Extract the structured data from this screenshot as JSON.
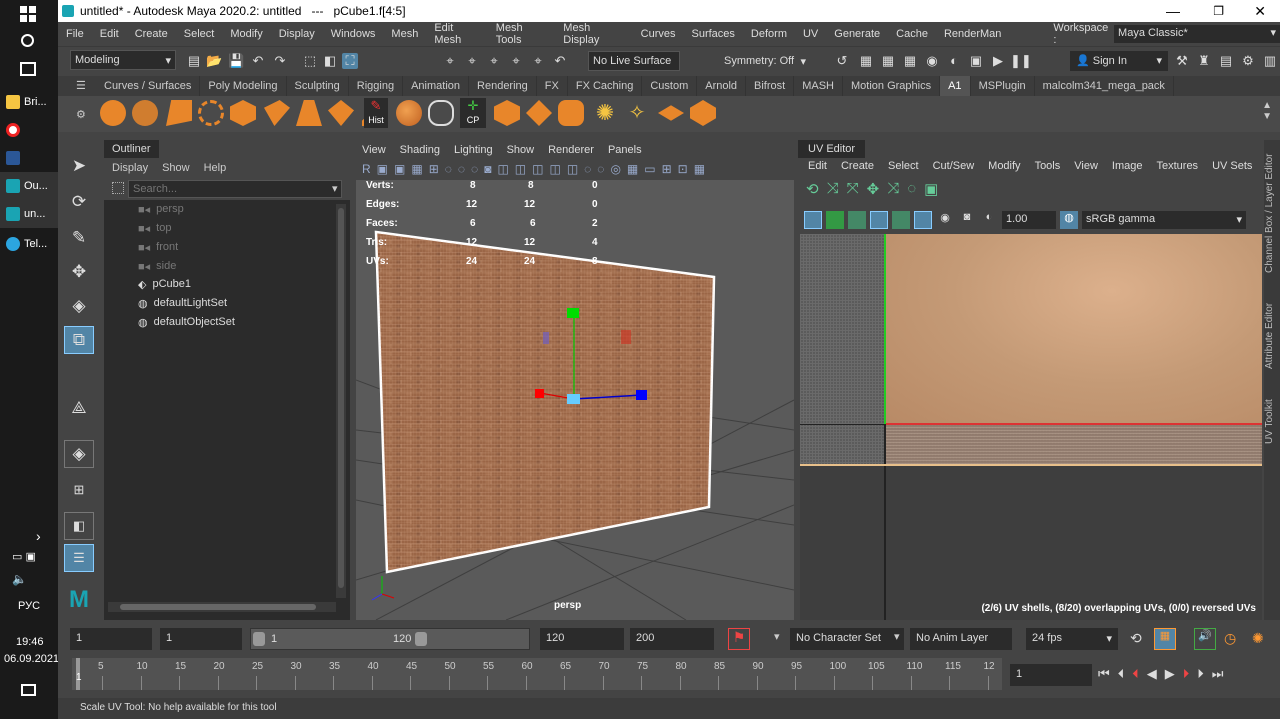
{
  "taskbar": {
    "items": [
      {
        "label": "Bri..."
      },
      {
        "label": ""
      },
      {
        "label": ""
      },
      {
        "label": "Ou..."
      },
      {
        "label": "un..."
      },
      {
        "label": "Tel..."
      }
    ],
    "lang": "РУС",
    "time": "19:46",
    "date": "06.09.2021"
  },
  "window": {
    "title": "untitled* - Autodesk Maya 2020.2: untitled   ---   pCube1.f[4:5]"
  },
  "menu": [
    "File",
    "Edit",
    "Create",
    "Select",
    "Modify",
    "Display",
    "Windows",
    "Mesh",
    "Edit Mesh",
    "Mesh Tools",
    "Mesh Display",
    "Curves",
    "Surfaces",
    "Deform",
    "UV",
    "Generate",
    "Cache",
    "RenderMan"
  ],
  "workspace": {
    "label": "Workspace :",
    "value": "Maya Classic*"
  },
  "statusline": {
    "mode": "Modeling",
    "live_surface": "No Live Surface",
    "symmetry": "Symmetry: Off",
    "sign_in": "Sign In"
  },
  "shelf_tabs": [
    "Curves / Surfaces",
    "Poly Modeling",
    "Sculpting",
    "Rigging",
    "Animation",
    "Rendering",
    "FX",
    "FX Caching",
    "Custom",
    "Arnold",
    "Bifrost",
    "MASH",
    "Motion Graphics",
    "A1",
    "MSPlugin",
    "malcolm341_mega_pack"
  ],
  "shelf_active": "A1",
  "shelf_labels": {
    "hist": "Hist",
    "cp": "CP"
  },
  "outliner": {
    "title": "Outliner",
    "menu": [
      "Display",
      "Show",
      "Help"
    ],
    "search_placeholder": "Search...",
    "items": [
      {
        "label": "persp",
        "type": "camera",
        "dim": true
      },
      {
        "label": "top",
        "type": "camera",
        "dim": true
      },
      {
        "label": "front",
        "type": "camera",
        "dim": true
      },
      {
        "label": "side",
        "type": "camera",
        "dim": true
      },
      {
        "label": "pCube1",
        "type": "mesh",
        "dim": false
      },
      {
        "label": "defaultLightSet",
        "type": "set",
        "dim": false
      },
      {
        "label": "defaultObjectSet",
        "type": "set",
        "dim": false
      }
    ]
  },
  "viewport": {
    "menu": [
      "View",
      "Shading",
      "Lighting",
      "Show",
      "Renderer",
      "Panels"
    ],
    "camera": "persp",
    "hud": [
      {
        "label": "Verts:",
        "a": "8",
        "b": "8",
        "c": "0"
      },
      {
        "label": "Edges:",
        "a": "12",
        "b": "12",
        "c": "0"
      },
      {
        "label": "Faces:",
        "a": "6",
        "b": "6",
        "c": "2"
      },
      {
        "label": "Tris:",
        "a": "12",
        "b": "12",
        "c": "4"
      },
      {
        "label": "UVs:",
        "a": "24",
        "b": "24",
        "c": "8"
      }
    ]
  },
  "uv_editor": {
    "title": "UV Editor",
    "menu": [
      "Edit",
      "Create",
      "Select",
      "Cut/Sew",
      "Modify",
      "Tools",
      "View",
      "Image",
      "Textures",
      "UV Sets"
    ],
    "exposure": "1.00",
    "color_space": "sRGB gamma",
    "status": "(2/6) UV shells, (8/20) overlapping UVs, (0/0) reversed UVs"
  },
  "side_tabs": [
    "Channel Box / Layer Editor",
    "Attribute Editor",
    "UV Toolkit"
  ],
  "range": {
    "start": "1",
    "current_start": "1",
    "slider_start": "1",
    "slider_end": "120",
    "end": "120",
    "max": "200",
    "character_set": "No Character Set",
    "anim_layer": "No Anim Layer",
    "fps": "24 fps"
  },
  "timeline": {
    "ticks": [
      "5",
      "10",
      "15",
      "20",
      "25",
      "30",
      "35",
      "40",
      "45",
      "50",
      "55",
      "60",
      "65",
      "70",
      "75",
      "80",
      "85",
      "90",
      "95",
      "100",
      "105",
      "110",
      "115",
      "12"
    ],
    "current_frame": "1",
    "frame_field": "1"
  },
  "help_line": "Scale UV Tool: No help available for this tool",
  "colors": {
    "accent": "#5285a6",
    "brick": "#a0694a",
    "uv_bg": "#c49a76",
    "active_tab": "#545454"
  }
}
